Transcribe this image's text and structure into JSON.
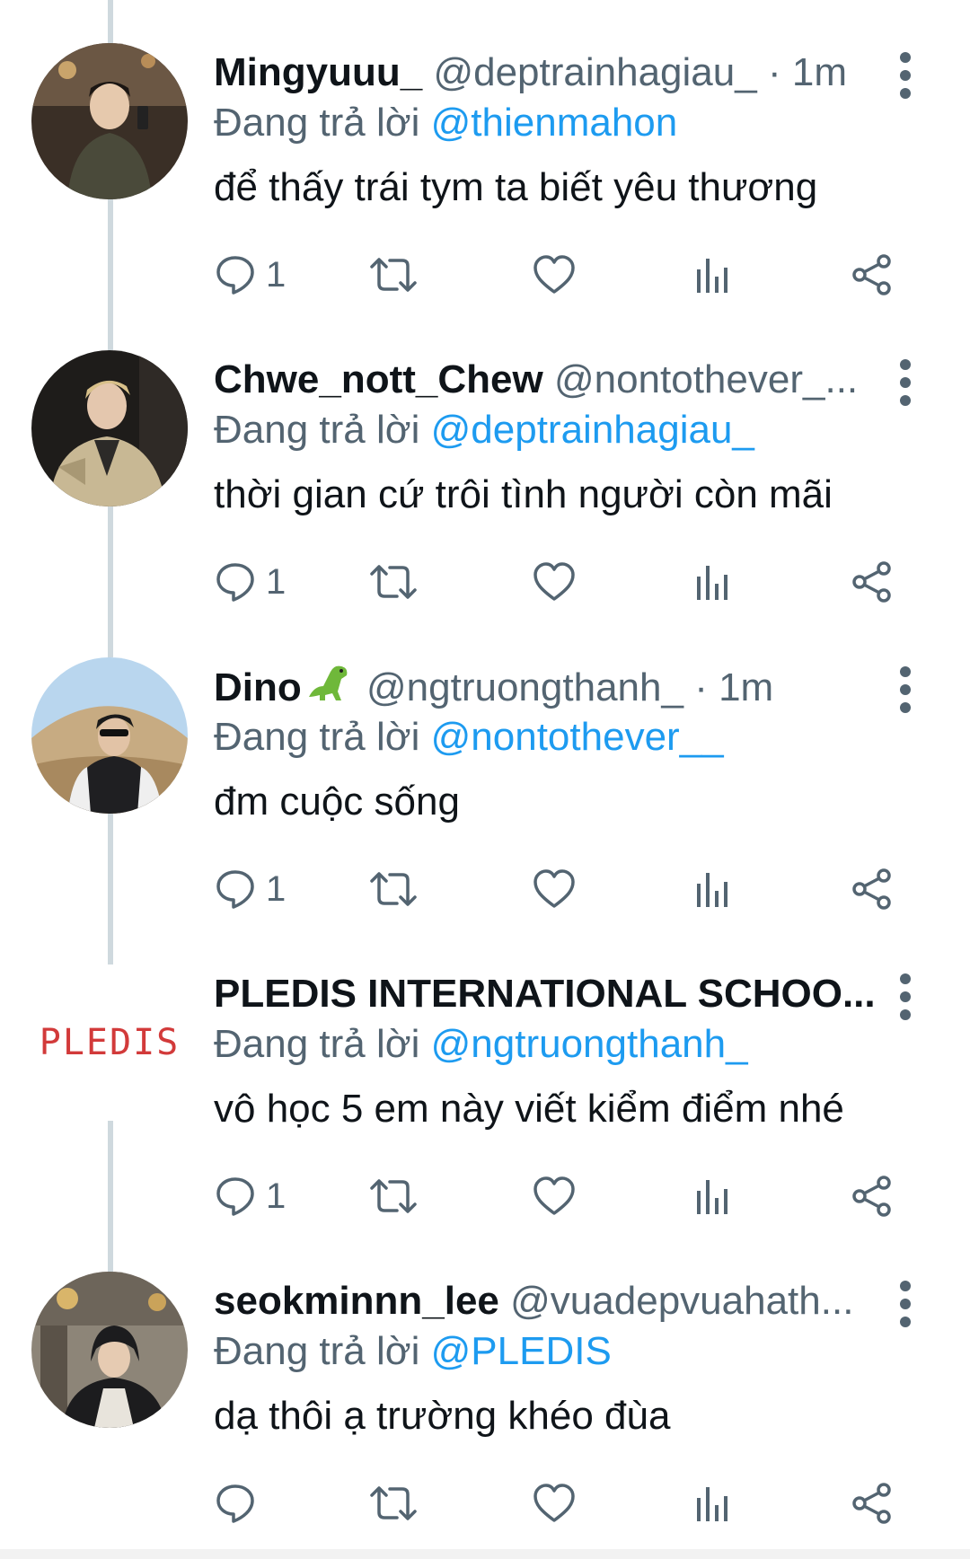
{
  "colors": {
    "text": "#0f1419",
    "secondary": "#536471",
    "link": "#1d9bf0",
    "thread_line": "#cfd9de",
    "logo_red": "#d23a3a"
  },
  "tweets": [
    {
      "name": "Mingyuuu_",
      "handle": "@deptrainhagiau_",
      "separator": "·",
      "time": "1m",
      "reply_prefix": "Đang trả lời",
      "reply_to": "@thienmahon",
      "text": "để thấy trái tym ta biết yêu thương",
      "reply_count": "1",
      "avatar": "photo-man-indoor"
    },
    {
      "name": "Chwe_nott_Chew",
      "handle": "@nontothever_...",
      "separator": "",
      "time": "",
      "reply_prefix": "Đang trả lời",
      "reply_to": "@deptrainhagiau_",
      "text": "thời gian cứ trôi tình người còn mãi",
      "reply_count": "1",
      "avatar": "photo-man-sweater"
    },
    {
      "name": "Dino",
      "name_emoji": "dinosaur-emoji",
      "handle": "@ngtruongthanh_",
      "separator": "·",
      "time": "1m",
      "reply_prefix": "Đang trả lời",
      "reply_to": "@nontothever__",
      "text": "đm cuộc sống",
      "reply_count": "1",
      "avatar": "photo-man-outdoor"
    },
    {
      "name": "PLEDIS INTERNATIONAL SCHOO...",
      "handle": "",
      "separator": "",
      "time": "",
      "reply_prefix": "Đang trả lời",
      "reply_to": "@ngtruongthanh_",
      "text": "vô học 5 em này viết kiểm điểm nhé",
      "reply_count": "1",
      "avatar": "pledis-logo",
      "logo_text": "PLEDIS"
    },
    {
      "name": "seokminnn_lee",
      "handle": "@vuadepvuahath...",
      "separator": "",
      "time": "",
      "reply_prefix": "Đang trả lời",
      "reply_to": "@PLEDIS",
      "text": "dạ thôi ạ trường khéo đùa",
      "reply_count": "",
      "avatar": "photo-man-castle"
    }
  ]
}
